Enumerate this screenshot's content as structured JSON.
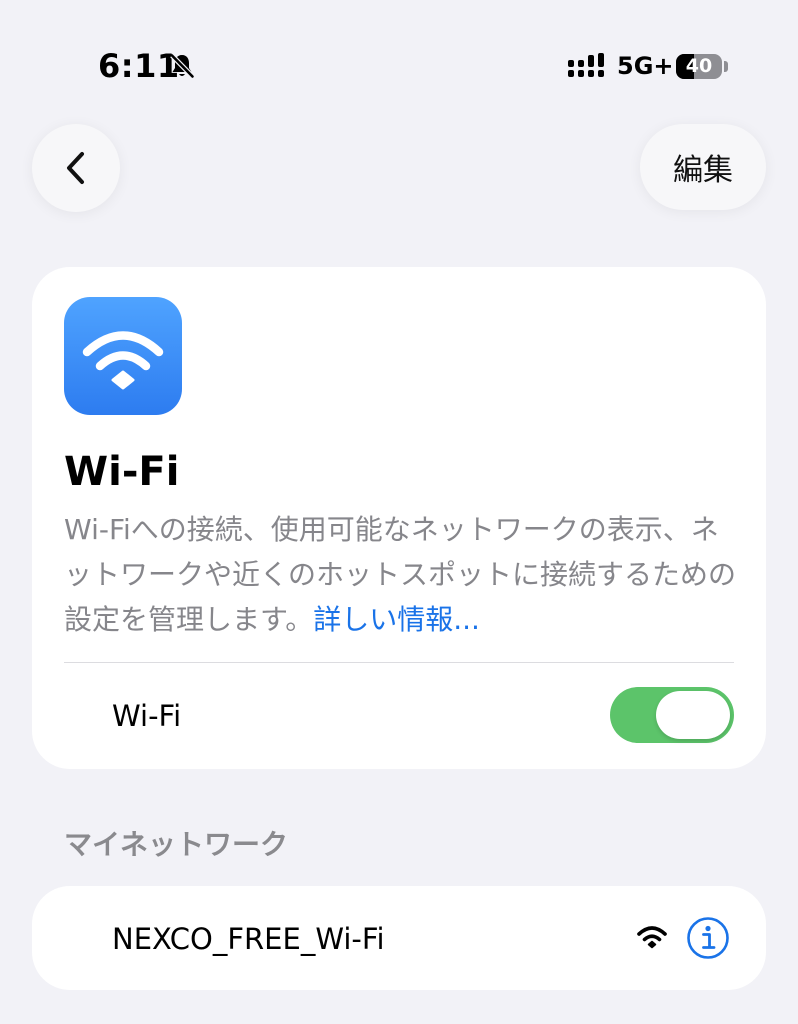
{
  "status_bar": {
    "time": "6:11",
    "mute_icon": "bell-slash-icon",
    "signal_icon": "cellular-signal-icon",
    "network_type": "5G+",
    "battery_level": "40",
    "battery_fraction": 0.4
  },
  "nav": {
    "back_icon": "chevron-left-icon",
    "edit_label": "編集"
  },
  "wifi_card": {
    "icon": "wifi-icon",
    "icon_color": "#2d7cf0",
    "title": "Wi-Fi",
    "description": "Wi-Fiへの接続、使用可能なネットワークの表示、ネットワークや近くのホットスポットに接続するための設定を管理します。",
    "learn_more": "詳しい情報...",
    "toggle_label": "Wi-Fi",
    "toggle_on": true,
    "toggle_color": "#5cc46a"
  },
  "my_networks": {
    "header": "マイネットワーク",
    "items": [
      {
        "name": "NEXCO_FREE_Wi-Fi",
        "signal_icon": "wifi-signal-icon",
        "info_icon": "info-circle-icon"
      }
    ]
  },
  "accent_color": "#1a73e8"
}
